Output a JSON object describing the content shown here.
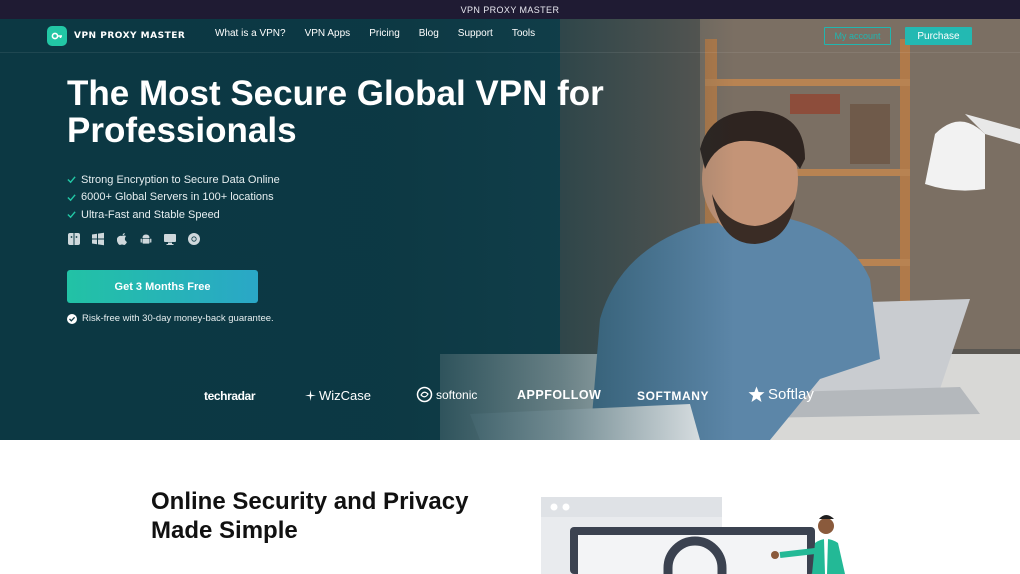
{
  "topbar": {
    "text": "VPN PROXY MASTER"
  },
  "brand": {
    "name": "VPN PROXY MASTER",
    "accent": "#22c7a5"
  },
  "nav": {
    "items": [
      "What is a VPN?",
      "VPN Apps",
      "Pricing",
      "Blog",
      "Support",
      "Tools"
    ],
    "account_label": "My account",
    "purchase_label": "Purchase"
  },
  "hero": {
    "headline": "The Most Secure Global VPN for Professionals",
    "features": [
      "Strong Encryption to Secure Data Online",
      "6000+ Global Servers in 100+ locations",
      "Ultra-Fast and Stable Speed"
    ],
    "platform_icons": [
      "finder-icon",
      "windows-icon",
      "apple-icon",
      "android-icon",
      "monitor-icon",
      "chrome-icon"
    ],
    "cta_label": "Get 3 Months Free",
    "guarantee": "Risk-free with 30-day money-back guarantee."
  },
  "press": [
    "techradar",
    "WizCase",
    "softonic",
    "APPFOLLOW",
    "SOFTMANY",
    "Softlay"
  ],
  "section2": {
    "title": "Online Security and Privacy Made Simple"
  },
  "colors": {
    "topbar": "#1f1b33",
    "hero_bg": "#0e3a45",
    "cta_start": "#22c2a5",
    "cta_end": "#2aa7c7"
  }
}
